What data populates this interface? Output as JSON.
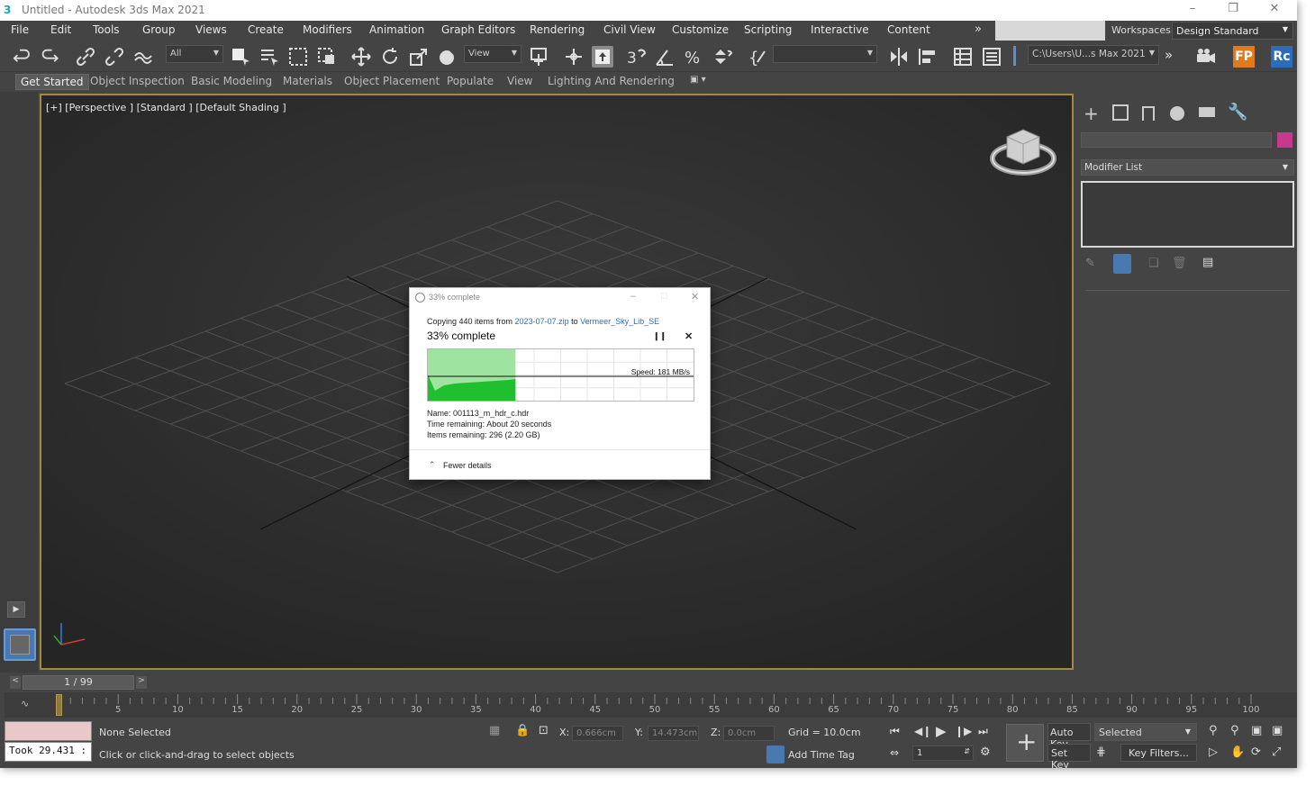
{
  "window": {
    "title": "Untitled - Autodesk 3ds Max 2021",
    "logo": "3"
  },
  "menu": {
    "items": [
      "File",
      "Edit",
      "Tools",
      "Group",
      "Views",
      "Create",
      "Modifiers",
      "Animation",
      "Graph Editors",
      "Rendering",
      "Civil View",
      "Customize",
      "Scripting",
      "Interactive",
      "Content"
    ],
    "workspaces_label": "Workspaces:",
    "workspace_value": "Design Standard"
  },
  "toolbar": {
    "selection_filter": "All",
    "ref_coord": "View",
    "named_selection": "",
    "project_path": "C:\\Users\\U...s Max 2021"
  },
  "ribbon": {
    "tabs": [
      "Get Started",
      "Object Inspection",
      "Basic Modeling",
      "Materials",
      "Object Placement",
      "Populate",
      "View",
      "Lighting And Rendering"
    ]
  },
  "viewport": {
    "label": "[+] [Perspective ] [Standard ] [Default Shading ]"
  },
  "command_panel": {
    "modifier_list": "Modifier List",
    "accent_color": "#c8388c"
  },
  "timeline": {
    "frame_display": "1 / 99",
    "ticks": [
      "5",
      "10",
      "15",
      "20",
      "25",
      "30",
      "35",
      "40",
      "45",
      "50",
      "55",
      "60",
      "65",
      "70",
      "75",
      "80",
      "85",
      "90",
      "95",
      "100"
    ]
  },
  "status": {
    "maxscript_output": "Took 29.431 :",
    "selection": "None Selected",
    "prompt": "Click or click-and-drag to select objects",
    "x_label": "X:",
    "x_value": "0.666cm",
    "y_label": "Y:",
    "y_value": "14.473cm",
    "z_label": "Z:",
    "z_value": "0.0cm",
    "grid": "Grid = 10.0cm",
    "add_time_tag": "Add Time Tag",
    "auto_key": "Auto Key",
    "set_key": "Set Key",
    "key_mode": "Selected",
    "key_filters": "Key Filters...",
    "current_frame": "1"
  },
  "dialog": {
    "title": "33% complete",
    "copying_prefix": "Copying 440 items from ",
    "source": "2023-07-07.zip",
    "to": " to ",
    "destination": "Vermeer_Sky_Lib_SE",
    "percent": "33% complete",
    "progress": 0.33,
    "speed": "Speed: 181 MB/s",
    "name": "Name:  001113_m_hdr_c.hdr",
    "time_remaining": "Time remaining:  About 20 seconds",
    "items_remaining": "Items remaining:  296 (2.20 GB)",
    "fewer_details": "Fewer details"
  }
}
